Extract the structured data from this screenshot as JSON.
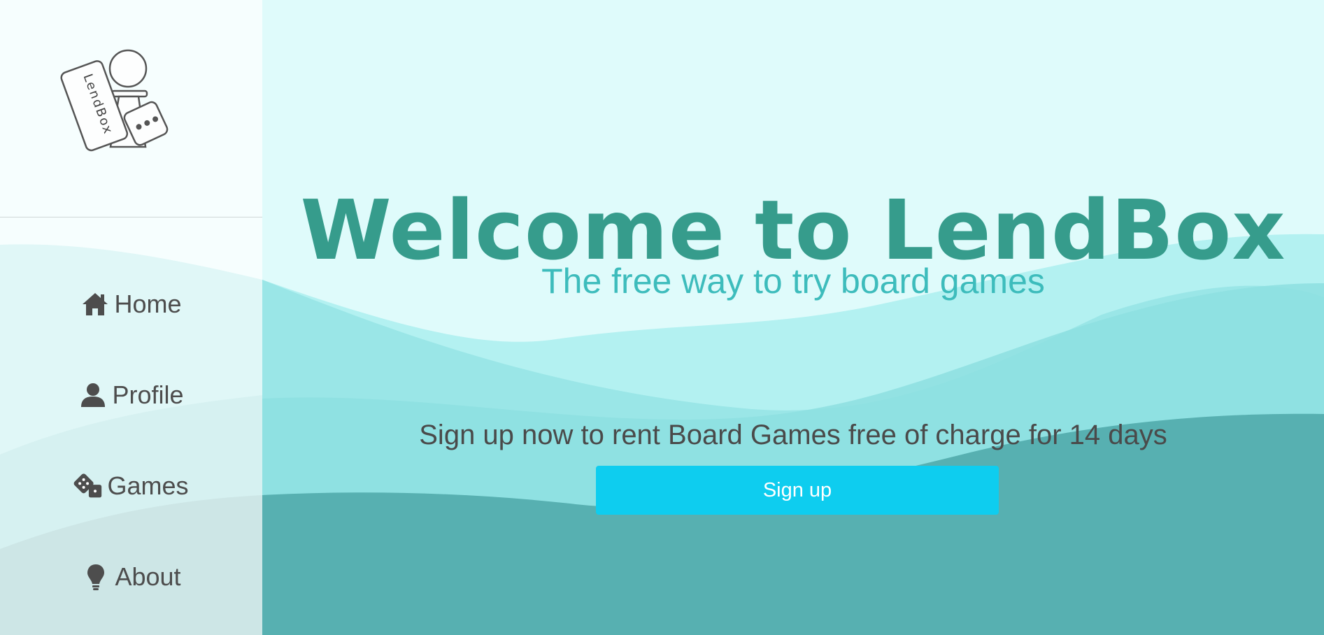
{
  "brand": {
    "logo_text": "LendBox"
  },
  "sidebar": {
    "items": [
      {
        "label": "Home",
        "icon": "home-icon"
      },
      {
        "label": "Profile",
        "icon": "user-icon"
      },
      {
        "label": "Games",
        "icon": "dice-icon"
      },
      {
        "label": "About",
        "icon": "lightbulb-icon"
      }
    ]
  },
  "hero": {
    "title": "Welcome to LendBox",
    "subtitle": "The free way to try board games",
    "cta_text": "Sign up now to rent Board Games free of charge for 14 days",
    "button_label": "Sign up"
  },
  "colors": {
    "title": "#369c8c",
    "subtitle": "#3dbcbc",
    "button": "#0ecdef",
    "wave_light": "#b3f1f1",
    "wave_mid": "#8ddfe0",
    "wave_dark": "#57b0b1",
    "background": "#dffbfb"
  }
}
